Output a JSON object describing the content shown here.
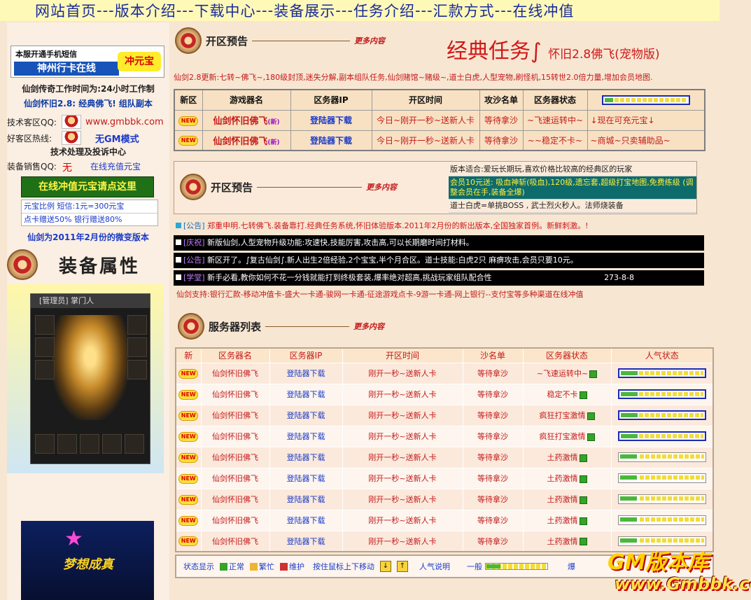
{
  "nav": {
    "items": [
      "网站首页",
      "版本介绍",
      "下载中心",
      "装备展示",
      "任务介绍",
      "汇款方式",
      "在线冲值"
    ],
    "separator": "---"
  },
  "left": {
    "banner_line1": "本服开通手机短信",
    "banner_line2": "神州行卡在线",
    "banner_badge": "冲元宝",
    "hours": "仙剑传奇工作时间为:24小时工作制",
    "version": "仙剑怀旧2.8: 经典佛飞! 组队副本",
    "tech_label": "技术客区QQ:",
    "site": "www.gmbbk.com",
    "hotline_label": "好客区热线:",
    "no_gm": "无GM模式",
    "support_center": "技术处理及投诉中心",
    "sales_label": "装备销售QQ:",
    "sales_value": "无",
    "recharge_link": "在线充值元宝",
    "online_btn": "在线冲值元宝请点这里",
    "ratio_line": "元宝比例 短信:1元=300元宝",
    "bonus_line": "点卡赠送50% 银行赠送80%",
    "version_note": "仙剑为2011年2月份的微变版本",
    "equip_title": "装备属性",
    "equip_header": "[管理员]  掌门人",
    "dream_text": "梦想成真"
  },
  "main": {
    "sec1_title": "开区预告",
    "more": "更多内容",
    "classic_title": "经典任务∫",
    "classic_sub": "怀旧2.8佛飞(宠物版)",
    "update_note": "仙剑2.8更新:七转~佛飞~,180级封顶,迷失分解,副本组队任务,仙剑赌馆~赌级~,道士白虎,人型宠物,刷怪机,15转世2.0倍力量,增加会员地图.",
    "t1_headers": [
      "新区",
      "游戏器名",
      "区务器IP",
      "开区时间",
      "攻沙名单",
      "区务器状态"
    ],
    "t1_rows": [
      {
        "badge": "NEW",
        "name": "仙剑怀旧佛飞",
        "sup": "(新)",
        "ip": "登陆器下载",
        "time": "今日~刚开一秒~送新人卡",
        "sand": "等待拿沙",
        "state": "~飞速运转中~",
        "extra": "↓现在可充元宝↓"
      },
      {
        "badge": "NEW",
        "name": "仙剑怀旧佛飞",
        "sup": "(新)",
        "ip": "登陆器下载",
        "time": "今日~刚开一秒~送新人卡",
        "sand": "等待拿沙",
        "state": "~~稳定不卡~",
        "extra": "~商城~只卖辅助品~"
      }
    ],
    "sec2_title": "开区预告",
    "notes": [
      "版本适合:爱玩长期玩,喜欢价格比较高的经典区的玩家",
      "会员10元送: 吸血神斩(吸血),120级,遗忘套,超级打宝地图,免费练级 (调整会员在手,装备全爆)",
      "道士白虎=单挑BOSS , 武士烈火秒人。法师烧装备"
    ],
    "ann1_tag": "[公告]",
    "ann1": "郑重申明.七转佛飞.装备靠打.经典任务系统,怀旧体验版本.2011年2月份的新出版本,全国独家首例。新鲜刺激。!",
    "ann2_tag": "[庆祝]",
    "ann2": "新版仙剑,人型宠物升级功能:攻速快,技能厉害,攻击高,可以长期磨时间打材料。",
    "ann3_tag": "[公告]",
    "ann3": "新区开了。∫复古仙剑∫.新人出生2倍经验,2个宝宝,半个月合区。道士技能:白虎2只 麻痹攻击,会员只要10元。",
    "ann4_tag": "[学堂]",
    "ann4": "新手必看,教你如何不花一分钱就能打到终极套装,爆率绝对超高,挑战玩家组队配合性",
    "ann4_code": "273-8-8",
    "support": "仙剑支持:银行汇款-移动冲值卡-盛大一卡通-骏网一卡通-征途游戏点卡-9游一卡通-网上银行--支付宝等多种渠道在线冲值",
    "sec3_title": "服务器列表",
    "t2_headers": [
      "新",
      "区务器名",
      "区务器IP",
      "开区时间",
      "沙名单",
      "区务器状态",
      "人气状态"
    ],
    "t2_rows": [
      {
        "name": "仙剑怀旧佛飞",
        "ip": "登陆器下载",
        "time": "刚开一秒~送新人卡",
        "sand": "等待拿沙",
        "state": "~飞速运转中~",
        "pop": 0.2,
        "box": true
      },
      {
        "name": "仙剑怀旧佛飞",
        "ip": "登陆器下载",
        "time": "刚开一秒~送新人卡",
        "sand": "等待拿沙",
        "state": "稳定不卡",
        "pop": 0.2,
        "box": true
      },
      {
        "name": "仙剑怀旧佛飞",
        "ip": "登陆器下载",
        "time": "刚开一秒~送新人卡",
        "sand": "等待拿沙",
        "state": "疯狂打宝激情",
        "pop": 0.2,
        "box": true
      },
      {
        "name": "仙剑怀旧佛飞",
        "ip": "登陆器下载",
        "time": "刚开一秒~送新人卡",
        "sand": "等待拿沙",
        "state": "疯狂打宝激情",
        "pop": 0.2,
        "box": true
      },
      {
        "name": "仙剑怀旧佛飞",
        "ip": "登陆器下载",
        "time": "刚开一秒~送新人卡",
        "sand": "等待拿沙",
        "state": "土药激情",
        "pop": 0.2,
        "box": false
      },
      {
        "name": "仙剑怀旧佛飞",
        "ip": "登陆器下载",
        "time": "刚开一秒~送新人卡",
        "sand": "等待拿沙",
        "state": "土药激情",
        "pop": 0.2,
        "box": false
      },
      {
        "name": "仙剑怀旧佛飞",
        "ip": "登陆器下载",
        "time": "刚开一秒~送新人卡",
        "sand": "等待拿沙",
        "state": "土药激情",
        "pop": 0.2,
        "box": false
      },
      {
        "name": "仙剑怀旧佛飞",
        "ip": "登陆器下载",
        "time": "刚开一秒~送新人卡",
        "sand": "等待拿沙",
        "state": "土药激情",
        "pop": 0.2,
        "box": false
      },
      {
        "name": "仙剑怀旧佛飞",
        "ip": "登陆器下载",
        "time": "刚开一秒~送新人卡",
        "sand": "等待拿沙",
        "state": "土药激情",
        "pop": 0.2,
        "box": false
      }
    ],
    "legend": {
      "label": "状态显示",
      "normal": "正常",
      "busy": "繁忙",
      "maint": "维护",
      "scroll": "按住鼠标上下移动",
      "pop_label": "人气说明",
      "general": "一般",
      "tail": "爆"
    }
  },
  "watermark": {
    "line1": "GM版本库",
    "line2": "www.Gmbbk.com"
  },
  "colors": {
    "accent": "#c41a1a",
    "link": "#1a3ac8",
    "nav": "#1a2a9a",
    "nav_bg": "#fff9b8",
    "page_bg": "#f7e6d2"
  }
}
